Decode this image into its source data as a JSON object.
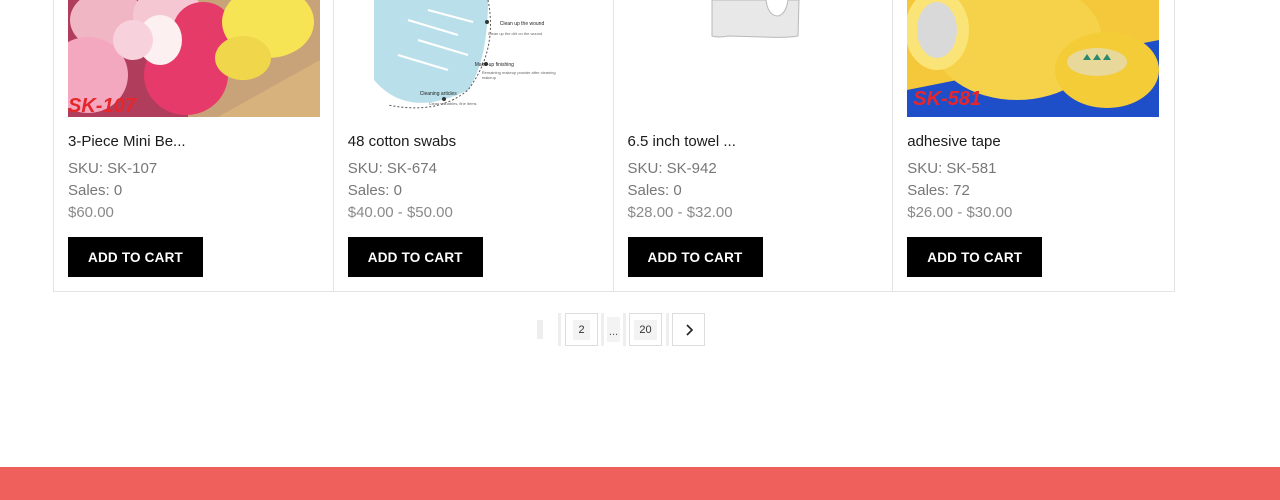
{
  "products": [
    {
      "title": "3-Piece Mini Be...",
      "sku": "SKU: SK-107",
      "sales": "Sales: 0",
      "price": "$60.00",
      "image_label": "SK-107",
      "cart_label": "ADD TO CART"
    },
    {
      "title": "48 cotton swabs",
      "sku": "SKU: SK-674",
      "sales": "Sales: 0",
      "price": "$40.00 - $50.00",
      "image_lines": [
        "Clean up the wound",
        "Clean up the dirt on the wound",
        "Make-up finishing",
        "Remaining makeup powder after cleaning makeup",
        "Cleaning articles",
        "Clean valuables, fine items"
      ],
      "cart_label": "ADD TO CART"
    },
    {
      "title": "6.5 inch towel ...",
      "sku": "SKU: SK-942",
      "sales": "Sales: 0",
      "price": "$28.00 - $32.00",
      "cart_label": "ADD TO CART"
    },
    {
      "title": "adhesive tape",
      "sku": "SKU: SK-581",
      "sales": "Sales: 72",
      "price": "$26.00 - $30.00",
      "image_label": "SK-581",
      "cart_label": "ADD TO CART"
    }
  ],
  "pagination": {
    "page_2": "2",
    "ellipsis": "...",
    "page_last": "20",
    "next_icon": "chevron-right-icon"
  },
  "colors": {
    "footer": "#ef5f5c",
    "button_bg": "#000000",
    "sku_label_red": "#e8262a"
  }
}
